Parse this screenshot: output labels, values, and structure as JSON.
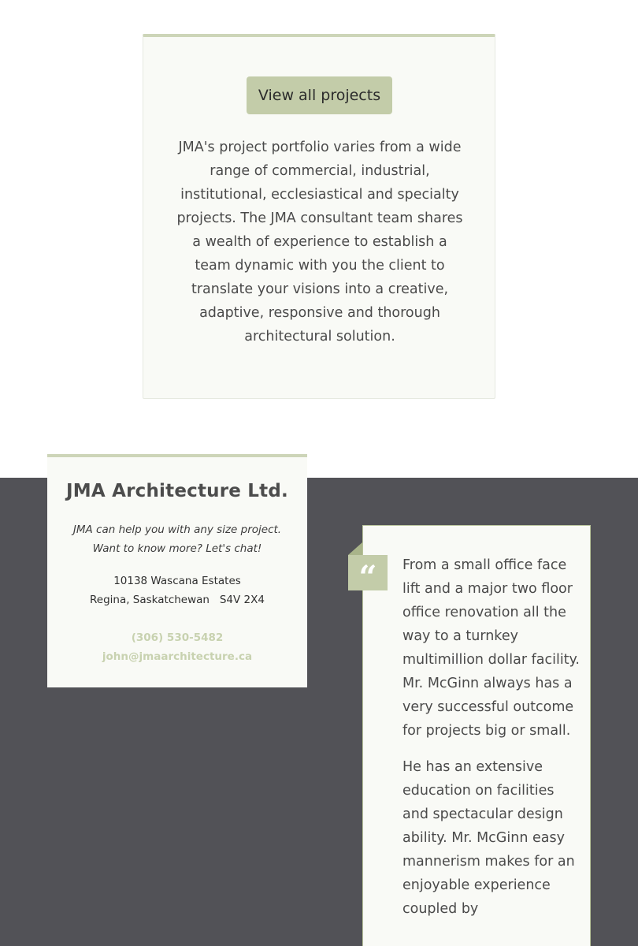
{
  "projects": {
    "button_label": "View all projects",
    "description": "JMA's project portfolio varies from a wide range of commercial, industrial, institutional, ecclesiastical and specialty projects. The JMA consultant team shares a wealth of experience to establish a team dynamic with you the client to translate your visions into a creative, adaptive, responsive and thorough architectural solution."
  },
  "contact": {
    "title": "JMA Architecture Ltd.",
    "tagline": "JMA can help you with any size project. Want to know more? Let's chat!",
    "address_line1": "10138 Wascana Estates",
    "address_line2": "Regina, Saskatchewan   S4V 2X4",
    "phone": "(306) 530-5482",
    "email": "john@jmaarchitecture.ca"
  },
  "testimonial": {
    "quote_icon": "quote-icon",
    "paragraphs": [
      "From a small office face lift and a major two floor office renovation all the way to a turnkey multimillion dollar facility. Mr. McGinn always has a very successful outcome for projects big or small.",
      "He has an extensive education on facilities and spectacular design ability. Mr. McGinn easy mannerism makes for an enjoyable experience coupled by"
    ]
  },
  "colors": {
    "accent": "#c3cca9",
    "accent_border": "#cdd5b8",
    "dark_band": "#525257",
    "card_bg": "#f9faf6",
    "link": "#c8d2b0"
  }
}
